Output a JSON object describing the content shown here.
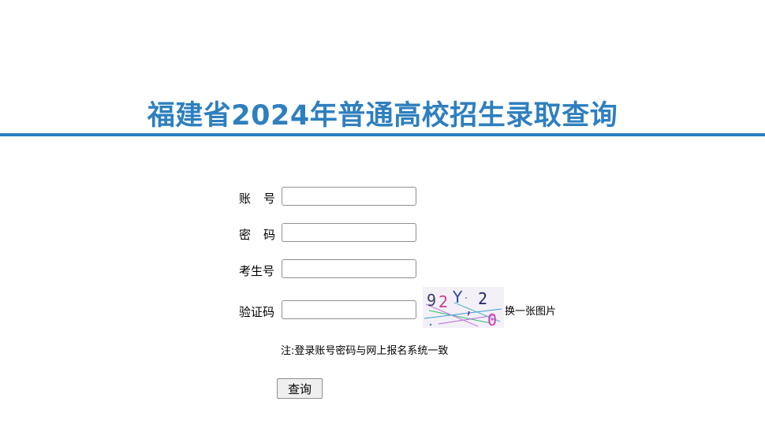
{
  "header": {
    "title": "福建省2024年普通高校招生录取查询",
    "accent_color": "#2e7fbf"
  },
  "form": {
    "account": {
      "label_1": "账",
      "label_2": "号",
      "value": "",
      "placeholder": ""
    },
    "password": {
      "label_1": "密",
      "label_2": "码",
      "value": "",
      "placeholder": ""
    },
    "exam_number": {
      "label": "考生号",
      "value": "",
      "placeholder": ""
    },
    "captcha": {
      "label": "验证码",
      "value": "",
      "placeholder": "",
      "image_text": "92Y,20",
      "refresh_label": "换一张图片"
    },
    "note": "注:登录账号密码与网上报名系统一致",
    "submit_label": "查询"
  }
}
